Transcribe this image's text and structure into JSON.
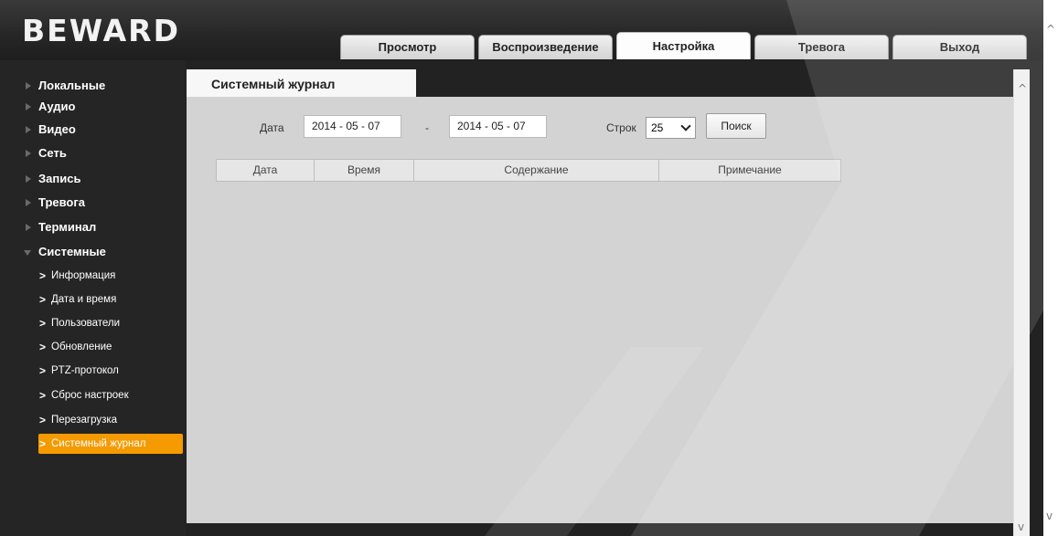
{
  "header": {
    "logo": "BeWARD",
    "tabs": [
      "Просмотр",
      "Воспроизведение",
      "Настройка",
      "Тревога",
      "Выход"
    ],
    "active_tab": "Настройка"
  },
  "sidebar": {
    "sections": [
      "Локальные",
      "Аудио",
      "Видео",
      "Сеть",
      "Запись",
      "Тревога",
      "Терминал",
      "Системные"
    ],
    "expanded_section": "Системные",
    "subitems": [
      "Информация",
      "Дата и время",
      "Пользователи",
      "Обновление",
      "PTZ-протокол",
      "Сброс настроек",
      "Перезагрузка",
      "Системный журнал"
    ],
    "active_subitem": "Системный журнал"
  },
  "page": {
    "tab_title": "Системный журнал",
    "date_label": "Дата",
    "date_from": "2014 - 05 - 07",
    "date_separator": "-",
    "date_to": "2014 - 05 - 07",
    "rows_label": "Строк",
    "rows_value": "25",
    "search_button": "Поиск"
  },
  "table": {
    "columns": [
      "Дата",
      "Время",
      "Содержание",
      "Примечание"
    ],
    "rows": []
  },
  "scrollbar": {
    "up": "^",
    "down": "v"
  },
  "colors": {
    "accent": "#f59a00",
    "background": "#252525",
    "content": "#d3d3d3"
  }
}
